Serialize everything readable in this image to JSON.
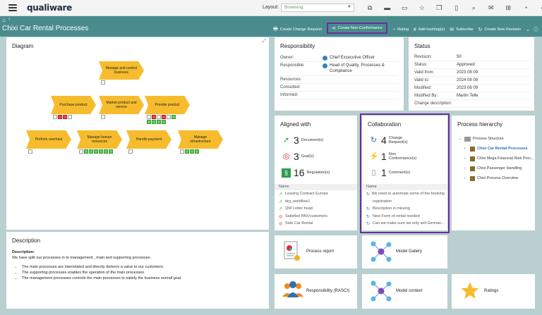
{
  "app": {
    "logo": "qualiware"
  },
  "header": {
    "layout_label": "Layout:",
    "layout_value": "Browsing",
    "icons": [
      "bookmark-icon",
      "folder-icon",
      "monitor-icon",
      "star-icon",
      "copy-icon",
      "document-icon",
      "search-icon",
      "mail-icon",
      "org-icon",
      "bell-icon",
      "user-icon"
    ]
  },
  "titlebar": {
    "home_glyph": "⌂",
    "sep": "›",
    "title": "Chixi Car Rental Processes",
    "actions": [
      {
        "icon": "🖶",
        "label": "Create Change Request"
      },
      {
        "icon": "⋖",
        "label": "Create Non-Conformance"
      },
      {
        "icon": "◔",
        "label": "Rating"
      },
      {
        "icon": "#",
        "label": "Add hashtag(s)"
      },
      {
        "icon": "✉",
        "label": "Subscribe"
      },
      {
        "icon": "↻",
        "label": "Create New Revision"
      }
    ]
  },
  "diagram": {
    "title": "Diagram",
    "shapes": [
      {
        "label": "Manage and control business"
      },
      {
        "label": "Purchase product"
      },
      {
        "label": "Market product and service"
      },
      {
        "label": "Provide product"
      },
      {
        "label": "Perform overhaul"
      },
      {
        "label": "Manage human resources"
      },
      {
        "label": "Handle payment"
      },
      {
        "label": "Manage infrastructure"
      }
    ]
  },
  "responsibility": {
    "title": "Responsibility",
    "rows": [
      {
        "key": "Owner:",
        "value": "Chief Excecutive Officer"
      },
      {
        "key": "Responsible:",
        "value": "Head of Quality, Processes & Compliance"
      },
      {
        "key": "Resources:",
        "value": ""
      },
      {
        "key": "Consulted:",
        "value": ""
      },
      {
        "key": "Informed:",
        "value": ""
      }
    ]
  },
  "status": {
    "title": "Status",
    "rows": [
      {
        "key": "Revision:",
        "value": "50"
      },
      {
        "key": "Status:",
        "value": "Approved"
      },
      {
        "key": "Valid from:",
        "value": "2023 08 09"
      },
      {
        "key": "Valid to:",
        "value": "2024 08 08"
      },
      {
        "key": "Modified:",
        "value": "2023 08 09"
      },
      {
        "key": "Modified By:",
        "value": "Martin Telle"
      },
      {
        "key": "Change description:",
        "value": ""
      }
    ]
  },
  "aligned": {
    "title": "Aligned with",
    "stats": [
      {
        "num": "3",
        "label": "Document(s)"
      },
      {
        "num": "3",
        "label": "Goal(s)"
      },
      {
        "num": "16",
        "label": "Regulation(s)"
      }
    ],
    "list_header": "Name",
    "items": [
      "Leasing Contract Europe",
      "drg_workflow1",
      "QW Letter head",
      "Satisfied PAX/customers",
      "Safe Car Rental"
    ]
  },
  "collaboration": {
    "title": "Collaboration",
    "stats": [
      {
        "num": "4",
        "label": "Change Request(s)"
      },
      {
        "num": "1",
        "label": "Non Conformance(s)"
      },
      {
        "num": "1",
        "label": "Comment(s)"
      }
    ],
    "list_header": "Name",
    "items": [
      "We need to automate some of the booking",
      "registration",
      "Bescription is missing",
      "New Form of rental needed",
      "Can we make sure we only sell German..."
    ]
  },
  "hierarchy": {
    "title": "Process hierarchy",
    "nodes": [
      {
        "label": "Process Structure"
      },
      {
        "label": "Chixi Car Rental Processes"
      },
      {
        "label": "Chixi Mega Financial Risk Proc..."
      },
      {
        "label": "Chixi Passenger Handling"
      },
      {
        "label": "Chixi Process Overview"
      }
    ]
  },
  "description": {
    "title": "Description",
    "heading": "Description:",
    "intro": "We have split our processes in to management , main and supporting processes.",
    "bullets": [
      "The main processes are interrelated and directly delivers a value to our customers.",
      "The supporting processes enables the operation of the main processes.",
      "The management processes controls the main processes to satisfy the business overall goal."
    ]
  },
  "tiles": {
    "process_report": "Process report",
    "model_gallery": "Model Gallery",
    "responsibility_rasci": "Responsibility (RASCI)",
    "model_context": "Model context",
    "ratings": "Ratings"
  },
  "colors": {
    "teal": "#4a8c8e",
    "accent_purple": "#6b2e9a",
    "chevron": "#f6bc2d"
  }
}
